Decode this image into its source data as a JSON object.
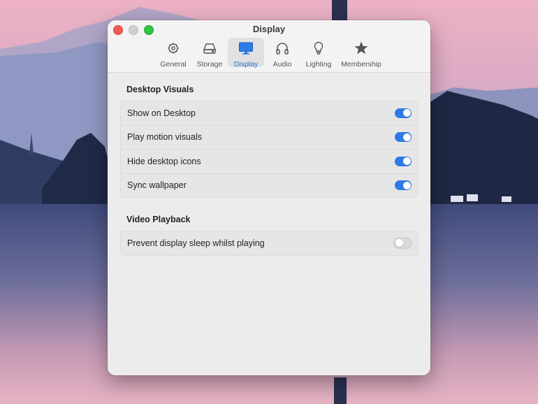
{
  "window": {
    "title": "Display"
  },
  "toolbar": {
    "tabs": [
      {
        "label": "General",
        "icon": "gear-icon",
        "active": false
      },
      {
        "label": "Storage",
        "icon": "drive-icon",
        "active": false
      },
      {
        "label": "Display",
        "icon": "monitor-icon",
        "active": true
      },
      {
        "label": "Audio",
        "icon": "headphones-icon",
        "active": false
      },
      {
        "label": "Lighting",
        "icon": "lightbulb-icon",
        "active": false
      },
      {
        "label": "Membership",
        "icon": "star-icon",
        "active": false
      }
    ]
  },
  "sections": [
    {
      "title": "Desktop Visuals",
      "rows": [
        {
          "label": "Show on Desktop",
          "enabled": true
        },
        {
          "label": "Play motion visuals",
          "enabled": true
        },
        {
          "label": "Hide desktop icons",
          "enabled": true
        },
        {
          "label": "Sync wallpaper",
          "enabled": true
        }
      ]
    },
    {
      "title": "Video Playback",
      "rows": [
        {
          "label": "Prevent display sleep whilst playing",
          "enabled": false
        }
      ]
    }
  ],
  "colors": {
    "accent": "#2e7be6",
    "close": "#ee5d56",
    "maximize": "#2fc441"
  }
}
